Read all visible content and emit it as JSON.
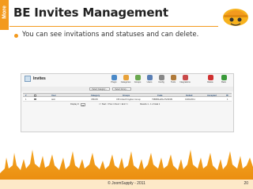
{
  "side_tab": {
    "label": "More"
  },
  "slide": {
    "title": "BE Invites Management",
    "bullet": "You can see invitations and statuses and can delete.",
    "footer": "© JoomSupply - 2011",
    "page_number": "20"
  },
  "admin": {
    "title": "Invites",
    "toolbar": [
      {
        "label": "Plugin",
        "icon": "plugin-icon",
        "color": "#4a89c8"
      },
      {
        "label": "Categories",
        "icon": "categories-icon",
        "color": "#e8a23a"
      },
      {
        "label": "Groups",
        "icon": "groups-icon",
        "color": "#6aa84f"
      },
      {
        "label": "Users",
        "icon": "users-icon",
        "color": "#5a7fb5"
      },
      {
        "label": "Config",
        "icon": "config-icon",
        "color": "#888888"
      },
      {
        "label": "Tools",
        "icon": "tools-icon",
        "color": "#b07a3a"
      },
      {
        "label": "Integrations",
        "icon": "integrations-icon",
        "color": "#c94a4a"
      },
      {
        "label": "Delete",
        "icon": "delete-icon",
        "color": "#d03030"
      },
      {
        "label": "Back",
        "icon": "back-icon",
        "color": "#3a9a3a"
      }
    ],
    "filters": {
      "category": "- Select Category -",
      "group": "- Select Group -"
    },
    "columns": [
      "#",
      "",
      "User",
      "Category",
      "Groups",
      "Code",
      "Invited",
      "Accepted",
      "ID"
    ],
    "rows": [
      {
        "num": "1",
        "user": "testr",
        "category": "CBGS5",
        "group": "CB United Kingdom Group",
        "code": "79889f4a4f1ef7e549f9",
        "invited": "01/04/2011",
        "accepted": "",
        "id": "1"
      }
    ],
    "pagination": {
      "display_label": "Display #",
      "display_value": "20",
      "nav": "<< Start < Prev 1 Next > End >>",
      "results": "Results 1 - 1 of total 1"
    }
  },
  "colors": {
    "accent": "#f39a1e",
    "footer_band": "#fde9c8"
  }
}
